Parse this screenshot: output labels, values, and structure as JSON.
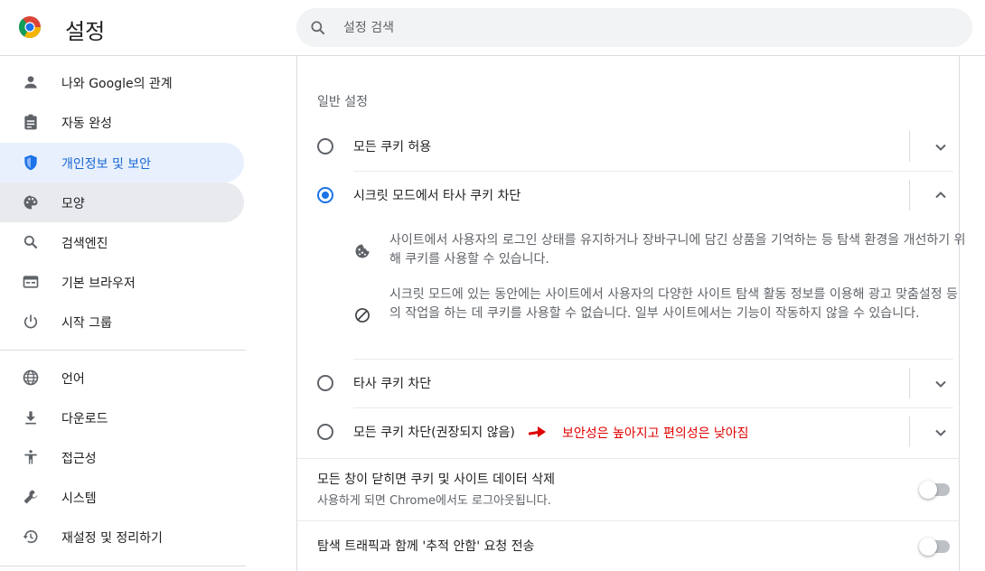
{
  "header": {
    "title": "설정",
    "search_placeholder": "설정 검색"
  },
  "sidebar": {
    "items": [
      {
        "label": "나와 Google의 관계",
        "icon": "person-icon"
      },
      {
        "label": "자동 완성",
        "icon": "clipboard-icon"
      },
      {
        "label": "개인정보 및 보안",
        "icon": "shield-icon",
        "active": true
      },
      {
        "label": "모양",
        "icon": "palette-icon",
        "hover": true
      },
      {
        "label": "검색엔진",
        "icon": "search-icon"
      },
      {
        "label": "기본 브라우저",
        "icon": "browser-icon"
      },
      {
        "label": "시작 그룹",
        "icon": "power-icon"
      },
      {
        "label": "언어",
        "icon": "globe-icon"
      },
      {
        "label": "다운로드",
        "icon": "download-icon"
      },
      {
        "label": "접근성",
        "icon": "accessibility-icon"
      },
      {
        "label": "시스템",
        "icon": "wrench-icon"
      },
      {
        "label": "재설정 및 정리하기",
        "icon": "restore-icon"
      }
    ]
  },
  "main": {
    "section_title": "일반 설정",
    "options": [
      {
        "label": "모든 쿠키 허용",
        "checked": false,
        "expanded": false
      },
      {
        "label": "시크릿 모드에서 타사 쿠키 차단",
        "checked": true,
        "expanded": true
      },
      {
        "label": "타사 쿠키 차단",
        "checked": false,
        "expanded": false
      },
      {
        "label": "모든 쿠키 차단(권장되지 않음)",
        "checked": false,
        "expanded": false
      }
    ],
    "details": [
      {
        "icon": "cookie-icon",
        "text": "사이트에서 사용자의 로그인 상태를 유지하거나 장바구니에 담긴 상품을 기억하는 등 탐색 환경을 개선하기 위해 쿠키를 사용할 수 있습니다."
      },
      {
        "icon": "block-icon",
        "text": "시크릿 모드에 있는 동안에는 사이트에서 사용자의 다양한 사이트 탐색 활동 정보를 이용해 광고 맞춤설정 등의 작업을 하는 데 쿠키를 사용할 수 없습니다. 일부 사이트에서는 기능이 작동하지 않을 수 있습니다."
      }
    ],
    "annotation": "보안성은 높아지고 편의성은 낮아짐",
    "toggles": [
      {
        "title": "모든 창이 닫히면 쿠키 및 사이트 데이터 삭제",
        "subtitle": "사용하게 되면 Chrome에서도 로그아웃됩니다.",
        "on": false
      },
      {
        "title": "탐색 트래픽과 함께 '추적 안함' 요청 전송",
        "on": false
      }
    ]
  },
  "colors": {
    "accent": "#1a73e8",
    "active_bg": "#e8f0fe",
    "annotation": "#e00000"
  }
}
